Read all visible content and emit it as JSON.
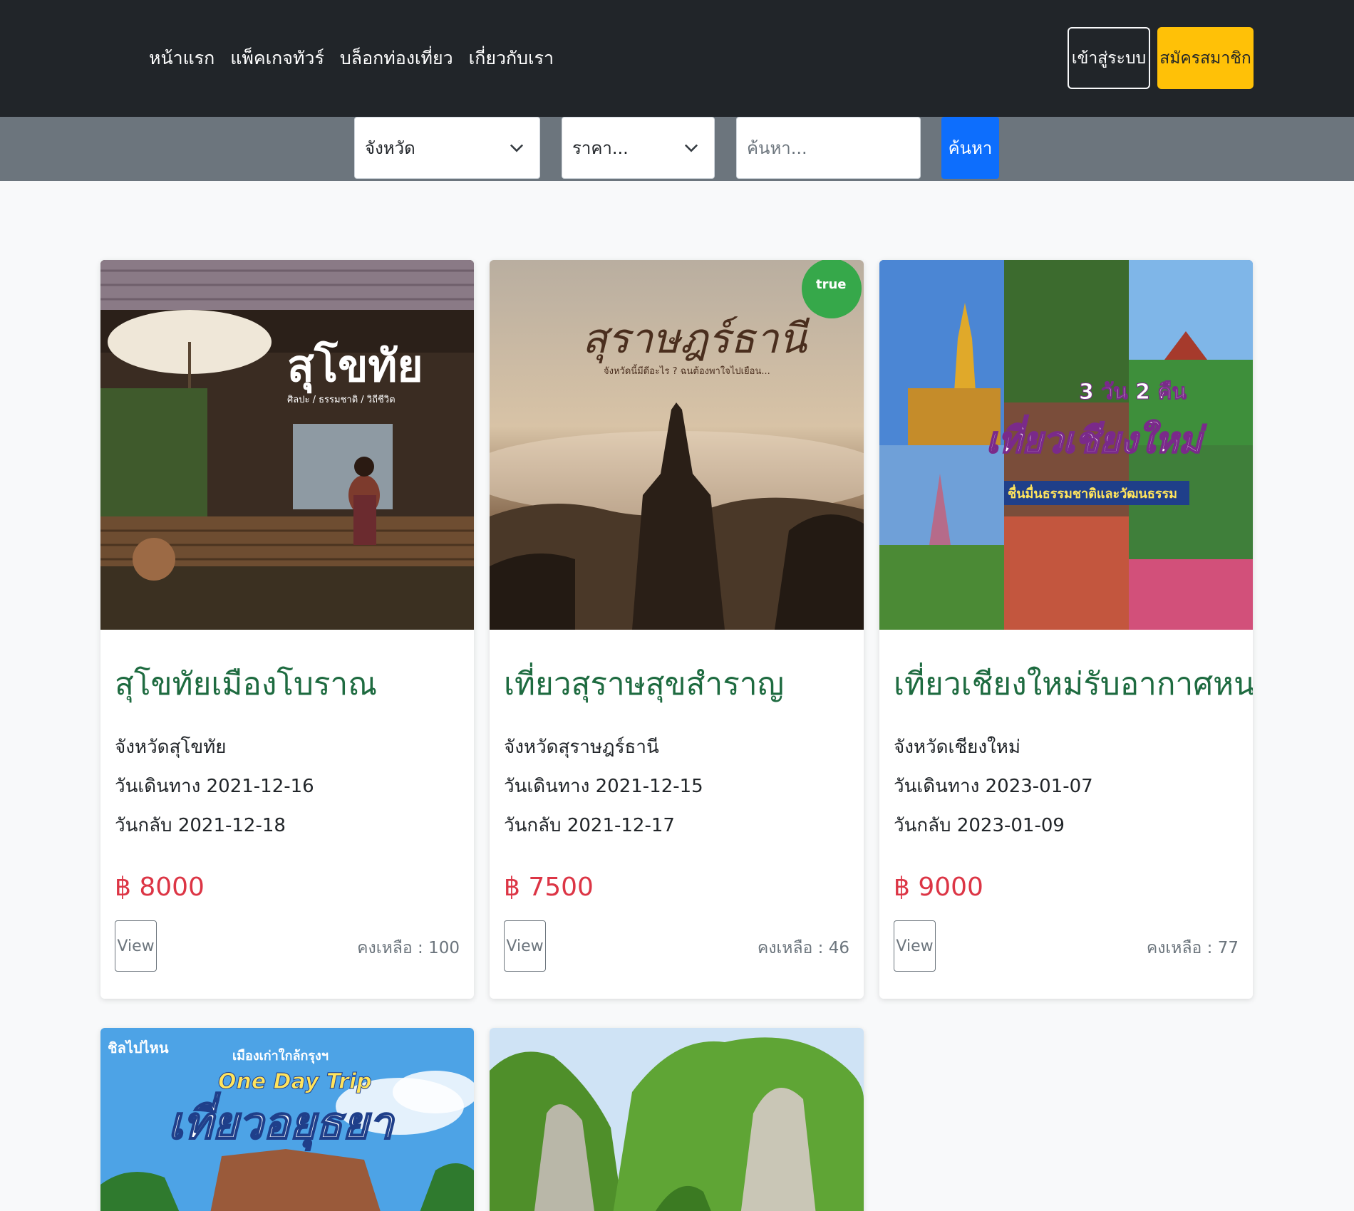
{
  "nav": {
    "links": [
      "หน้าแรก",
      "แพ็คเกจทัวร์",
      "บล็อกท่องเที่ยว",
      "เกี่ยวกับเรา"
    ],
    "login_label": "เข้าสู่ระบบ",
    "signup_label": "สมัครสมาชิก"
  },
  "search": {
    "province_selected": "จังหวัด",
    "price_selected": "ราคา...",
    "query_placeholder": "ค้นหา...",
    "query_value": "",
    "button_label": "ค้นหา"
  },
  "tours": [
    {
      "title": "สุโขทัยเมืองโบราณ",
      "province": "จังหวัดสุโขทัย",
      "depart": "วันเดินทาง 2021-12-16",
      "return": "วันกลับ 2021-12-18",
      "price": "฿ 8000",
      "view_label": "View",
      "remaining": "คงเหลือ : 100",
      "image_text": "สุโขทัย",
      "image_subtext": "ศิลปะ / ธรรมชาติ / วิถีชีวิต"
    },
    {
      "title": "เที่ยวสุราษสุขสำราญ",
      "province": "จังหวัดสุราษฎร์ธานี",
      "depart": "วันเดินทาง 2021-12-15",
      "return": "วันกลับ 2021-12-17",
      "price": "฿ 7500",
      "view_label": "View",
      "remaining": "คงเหลือ : 46",
      "image_text": "สุราษฎร์ธานี",
      "image_subtext": "จังหวัดนี้มีดีอะไร ? ฉนต้องพาใจไปเยือน...",
      "image_badge": "true"
    },
    {
      "title": "เที่ยวเชียงใหม่รับอากาศหนาว",
      "province": "จังหวัดเชียงใหม่",
      "depart": "วันเดินทาง 2023-01-07",
      "return": "วันกลับ 2023-01-09",
      "price": "฿ 9000",
      "view_label": "View",
      "remaining": "คงเหลือ : 77",
      "image_text": "เที่ยวเชียงใหม่",
      "image_subtext": "ชื่นมื่นธรรมชาติและวัฒนธรรม",
      "image_badge": "3 วัน 2 คืน"
    },
    {
      "image_text": "เที่ยวอยุธยา",
      "image_subtext": "One Day Trip",
      "image_badge": "เมืองเก่าใกล้กรุงฯ",
      "image_corner": "ชิลไปไหน"
    },
    {
      "image_text": ""
    }
  ],
  "colors": {
    "navbar": "#212529",
    "searchbar": "#6c757d",
    "signup": "#ffc107",
    "search_button": "#0d6efd",
    "title": "#1e6b40",
    "price": "#dc3545"
  },
  "icons": {
    "select_arrow": "chevron-down-icon"
  }
}
